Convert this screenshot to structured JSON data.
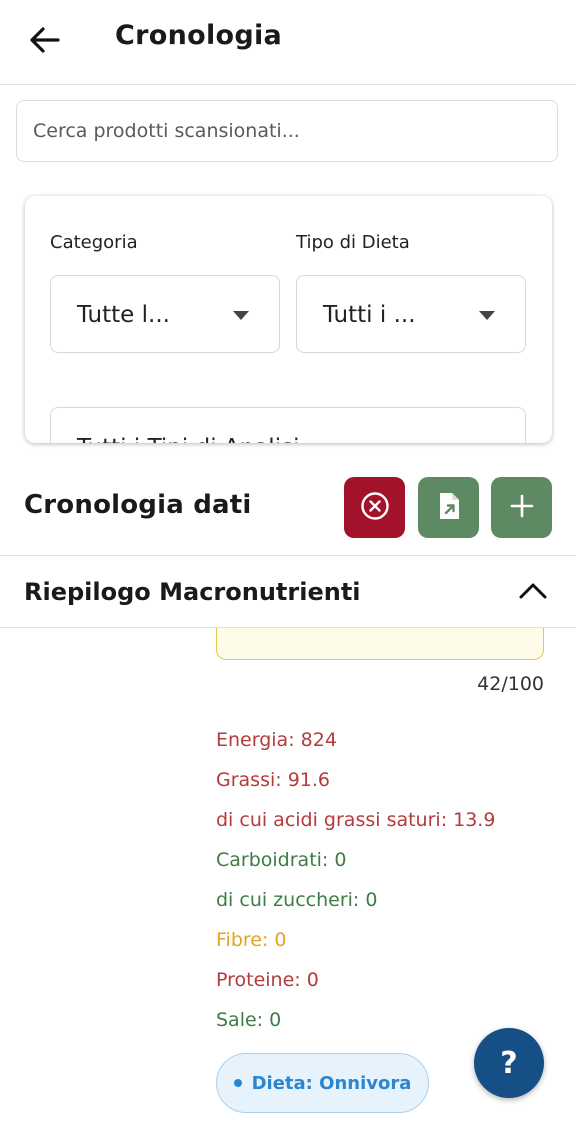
{
  "appbar": {
    "title": "Cronologia"
  },
  "search": {
    "placeholder": "Cerca prodotti scansionati..."
  },
  "filters": {
    "category_label": "Categoria",
    "category_value": "Tutte l...",
    "diet_label": "Tipo di Dieta",
    "diet_value": "Tutti i ...",
    "analysis_value": "Tutti i Tipi di Analisi"
  },
  "history": {
    "title": "Cronologia dati",
    "buttons": [
      {
        "icon": "clear-circle-icon",
        "color": "#a3122b"
      },
      {
        "icon": "export-file-icon",
        "color": "#5e8a63"
      },
      {
        "icon": "plus-icon",
        "color": "#5e8a63"
      }
    ]
  },
  "macros": {
    "title": "Riepilogo Macronutrienti",
    "score": "42/100",
    "items": [
      {
        "text": "Energia: 824",
        "color": "#b53a3a"
      },
      {
        "text": "Grassi: 91.6",
        "color": "#b53a3a"
      },
      {
        "text": "di cui acidi grassi saturi: 13.9",
        "color": "#b53a3a"
      },
      {
        "text": "Carboidrati: 0",
        "color": "#3d7d43"
      },
      {
        "text": "di cui zuccheri: 0",
        "color": "#3d7d43"
      },
      {
        "text": "Fibre: 0",
        "color": "#e3a324"
      },
      {
        "text": "Proteine: 0",
        "color": "#b53a3a"
      },
      {
        "text": "Sale: 0",
        "color": "#3d7d43"
      }
    ],
    "diet_chip": "Dieta: Onnivora"
  },
  "help": {
    "label": "?"
  }
}
